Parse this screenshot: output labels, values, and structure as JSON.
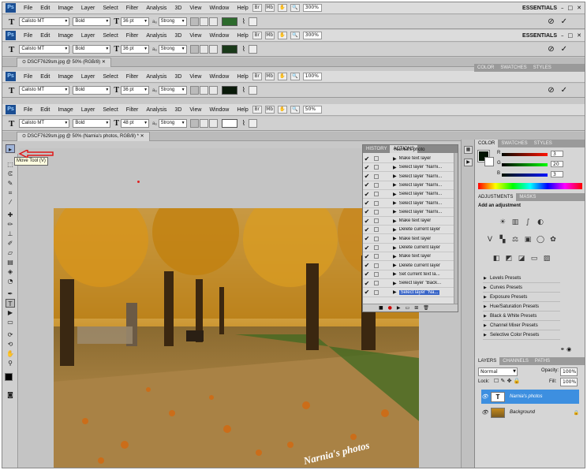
{
  "app": {
    "logo": "Ps"
  },
  "menus": [
    "File",
    "Edit",
    "Image",
    "Layer",
    "Select",
    "Filter",
    "Analysis",
    "3D",
    "View",
    "Window",
    "Help"
  ],
  "workspace": "ESSENTIALS",
  "zoom_values": [
    "300%",
    "300%",
    "100%",
    "100%",
    "50%",
    "50%"
  ],
  "options": {
    "font_family": "Calisto MT",
    "font_style": "Bold",
    "font_sizes": [
      "36 pt",
      "36 pt",
      "36 pt",
      "36 pt",
      "48 pt"
    ],
    "antialias_label": "aₐ",
    "antialias": "Strong",
    "text_color_hex": [
      "#2d6b2d",
      "#1a3a1a",
      "#0a1a0a",
      "#0a1a0a",
      "#ffffff"
    ]
  },
  "doc_tabs": [
    "DSCF7629sm.jpg @ 50% (RGB/8)",
    "DSCF7629sm.jpg @ 50% (Narnia's photos, RGB/8) *"
  ],
  "tooltip": "Move Tool (V)",
  "history": {
    "tabs": [
      "HISTORY",
      "ACTIONS"
    ],
    "title": "Narnia's photo",
    "items": [
      "Make text layer",
      "Select layer \"Narni...",
      "Select layer \"Narni...",
      "Select layer \"Narni...",
      "Select layer \"Narni...",
      "Select layer \"Narni...",
      "Select layer \"Narni...",
      "Make text layer",
      "Delete current layer",
      "Make text layer",
      "Delete current layer",
      "Make text layer",
      "Delete current layer",
      "Set current text la...",
      "Select layer \"Back...",
      "Select layer \"Na..."
    ]
  },
  "color_panel": {
    "tabs": [
      "COLOR",
      "SWATCHES",
      "STYLES"
    ],
    "channels": [
      {
        "name": "R",
        "value": "3"
      },
      {
        "name": "G",
        "value": "20"
      },
      {
        "name": "B",
        "value": "3"
      }
    ]
  },
  "panel_top_tabs": [
    "COLOR",
    "SWATCHES",
    "STYLES"
  ],
  "adjustments": {
    "tabs": [
      "ADJUSTMENTS",
      "MASKS"
    ],
    "heading": "Add an adjustment",
    "presets": [
      "Levels Presets",
      "Curves Presets",
      "Exposure Presets",
      "Hue/Saturation Presets",
      "Black & White Presets",
      "Channel Mixer Presets",
      "Selective Color Presets"
    ]
  },
  "layers": {
    "tabs": [
      "LAYERS",
      "CHANNELS",
      "PATHS"
    ],
    "blend_mode": "Normal",
    "opacity_label": "Opacity:",
    "opacity": "100%",
    "lock_label": "Lock:",
    "fill_label": "Fill:",
    "fill": "100%",
    "items": [
      {
        "name": "Narnia's photos",
        "type": "text"
      },
      {
        "name": "Background",
        "type": "image"
      }
    ]
  },
  "watermark": "Narnia's photos"
}
